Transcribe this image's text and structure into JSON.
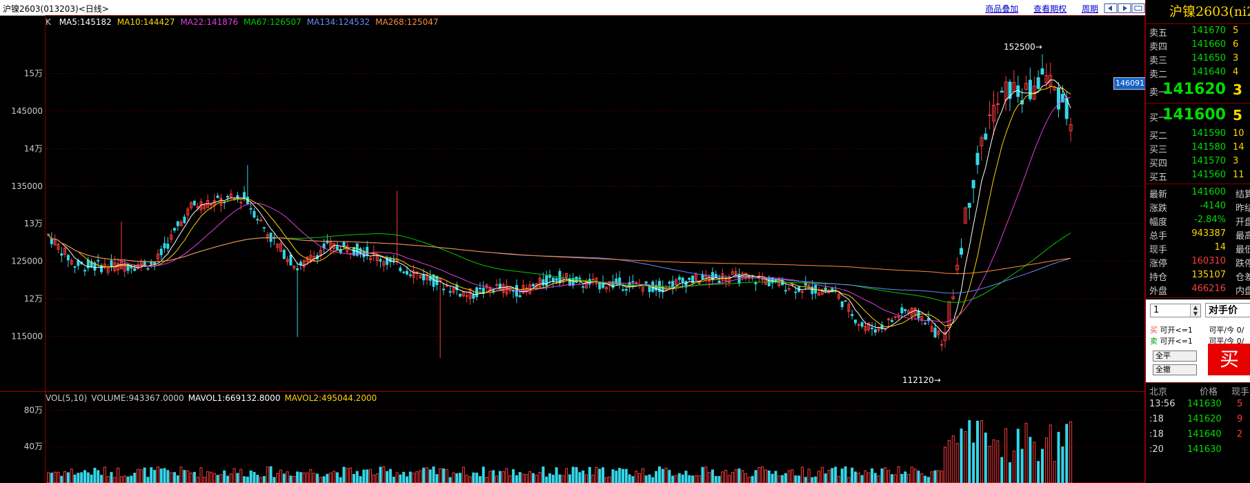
{
  "window": {
    "title": "沪镍2603(013203)<日线>",
    "links": [
      "商品叠加",
      "查看期权",
      "周期"
    ]
  },
  "legends": {
    "k_label": "K",
    "ma": [
      {
        "text": "MA5:145182",
        "color": "#ffffff"
      },
      {
        "text": "MA10:144427",
        "color": "#ffd700"
      },
      {
        "text": "MA22:141876",
        "color": "#e040e0"
      },
      {
        "text": "MA67:126507",
        "color": "#00cc00"
      },
      {
        "text": "MA134:124532",
        "color": "#6a8aff"
      },
      {
        "text": "MA268:125047",
        "color": "#ff8c3c"
      }
    ],
    "vol": [
      {
        "text": "VOL(5,10)",
        "color": "#cccccc"
      },
      {
        "text": "VOLUME:943367.0000",
        "color": "#cccccc"
      },
      {
        "text": "MAVOL1:669132.8000",
        "color": "#ffffff"
      },
      {
        "text": "MAVOL2:495044.2000",
        "color": "#ffd700"
      }
    ]
  },
  "chart_data": {
    "type": "candlestick",
    "price_axis": {
      "min": 110000,
      "max": 155000,
      "ticks": [
        "15万",
        "145000",
        "14万",
        "135000",
        "13万",
        "125000",
        "12万",
        "115000"
      ]
    },
    "volume_axis": {
      "ticks": [
        "80万",
        "40万"
      ],
      "max": 1000000
    },
    "annotations": {
      "high": "152500",
      "low": "112120"
    },
    "price_tag": "146091",
    "trend": {
      "start": 128500,
      "x_start": 0,
      "x_end": 1,
      "points": [
        [
          0,
          128500
        ],
        [
          0.03,
          124500
        ],
        [
          0.07,
          124300
        ],
        [
          0.12,
          124800
        ],
        [
          0.16,
          132300
        ],
        [
          0.19,
          133000
        ],
        [
          0.22,
          133500
        ],
        [
          0.25,
          128000
        ],
        [
          0.28,
          124000
        ],
        [
          0.31,
          127000
        ],
        [
          0.35,
          126500
        ],
        [
          0.39,
          124500
        ],
        [
          0.43,
          122500
        ],
        [
          0.47,
          120500
        ],
        [
          0.5,
          121500
        ],
        [
          0.53,
          121000
        ],
        [
          0.57,
          123000
        ],
        [
          0.6,
          122000
        ],
        [
          0.64,
          122000
        ],
        [
          0.68,
          121500
        ],
        [
          0.72,
          122500
        ],
        [
          0.76,
          123000
        ],
        [
          0.8,
          122500
        ],
        [
          0.84,
          121500
        ],
        [
          0.88,
          121000
        ],
        [
          0.91,
          116500
        ],
        [
          0.93,
          116000
        ],
        [
          0.96,
          118500
        ],
        [
          0.98,
          117500
        ],
        [
          1,
          114500
        ]
      ],
      "surge": [
        [
          0,
          114500
        ],
        [
          0.1,
          125000
        ],
        [
          0.22,
          136000
        ],
        [
          0.35,
          144000
        ],
        [
          0.5,
          148000
        ],
        [
          0.65,
          147000
        ],
        [
          0.8,
          150000
        ],
        [
          1,
          144000
        ]
      ]
    },
    "ma_colors": [
      "#ffffff",
      "#ffd700",
      "#e040e0",
      "#00cc00",
      "#6a8aff",
      "#ff8c3c"
    ]
  },
  "panel": {
    "title": "沪镍2603(ni2",
    "asks": [
      {
        "label": "卖五",
        "price": "141670",
        "vol": "5"
      },
      {
        "label": "卖四",
        "price": "141660",
        "vol": "6"
      },
      {
        "label": "卖三",
        "price": "141650",
        "vol": "3"
      },
      {
        "label": "卖二",
        "price": "141640",
        "vol": "4"
      }
    ],
    "ask1": {
      "label": "卖一",
      "price": "141620",
      "vol": "3"
    },
    "bid1": {
      "label": "买一",
      "price": "141600",
      "vol": "5"
    },
    "bids": [
      {
        "label": "买二",
        "price": "141590",
        "vol": "10"
      },
      {
        "label": "买三",
        "price": "141580",
        "vol": "14"
      },
      {
        "label": "买四",
        "price": "141570",
        "vol": "3"
      },
      {
        "label": "买五",
        "price": "141560",
        "vol": "11"
      }
    ],
    "stats": [
      {
        "k": "最新",
        "v": "141600",
        "k2": "结算",
        "cls": ""
      },
      {
        "k": "涨跌",
        "v": "-4140",
        "k2": "昨结",
        "cls": ""
      },
      {
        "k": "幅度",
        "v": "-2.84%",
        "k2": "开盘",
        "cls": ""
      },
      {
        "k": "总手",
        "v": "943387",
        "k2": "最高",
        "cls": "yel"
      },
      {
        "k": "现手",
        "v": "14",
        "k2": "最低",
        "cls": "yel"
      },
      {
        "k": "涨停",
        "v": "160310",
        "k2": "跌停",
        "cls": "red"
      },
      {
        "k": "持仓",
        "v": "135107",
        "k2": "仓差",
        "cls": "yel"
      },
      {
        "k": "外盘",
        "v": "466216",
        "k2": "内盘",
        "cls": "red"
      }
    ],
    "order": {
      "qty": "1",
      "price_type": "对手价",
      "buy_line": {
        "tag": "买",
        "open": "可开<=1",
        "close": "可平/今",
        "close_val": "0/"
      },
      "sell_line": {
        "tag": "卖",
        "open": "可开<=1",
        "close": "可平/今",
        "close_val": "0/"
      },
      "close_all": "全平",
      "cancel_all": "全撤",
      "buy_button": "买"
    },
    "ticks_header": {
      "time": "北京",
      "price": "价格",
      "qty": "现手"
    },
    "ticks": [
      {
        "time": "13:56",
        "price": "141630",
        "qty": "5"
      },
      {
        "time": ":18",
        "price": "141620",
        "qty": "9"
      },
      {
        "time": ":18",
        "price": "141640",
        "qty": "2"
      },
      {
        "time": ":20",
        "price": "141630",
        "qty": ""
      }
    ]
  }
}
